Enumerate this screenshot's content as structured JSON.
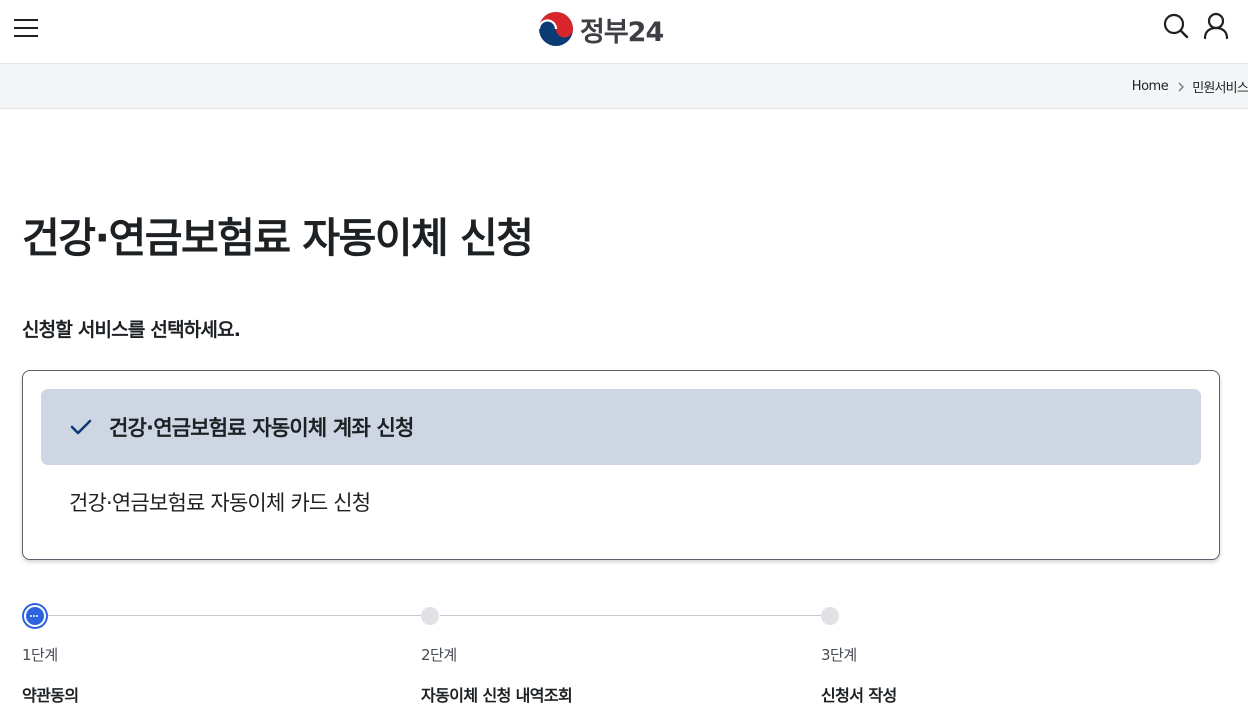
{
  "header": {
    "logo_text": "정부24"
  },
  "breadcrumb": {
    "home": "Home",
    "current": "민원서비스"
  },
  "page": {
    "title": "건강·연금보험료 자동이체 신청",
    "instruction": "신청할 서비스를 선택하세요."
  },
  "service_options": [
    {
      "label": "건강·연금보험료 자동이체 계좌 신청",
      "selected": true
    },
    {
      "label": "건강·연금보험료 자동이체 카드 신청",
      "selected": false
    }
  ],
  "steps": [
    {
      "number": "1단계",
      "name": "약관동의",
      "status": "current"
    },
    {
      "number": "2단계",
      "name": "자동이체 신청 내역조회",
      "status": "pending"
    },
    {
      "number": "3단계",
      "name": "신청서 작성",
      "status": "pending"
    }
  ],
  "colors": {
    "brand_blue": "#2e63df",
    "selected_option_bg": "#cdd6e2",
    "check_color": "#0b3b73"
  }
}
